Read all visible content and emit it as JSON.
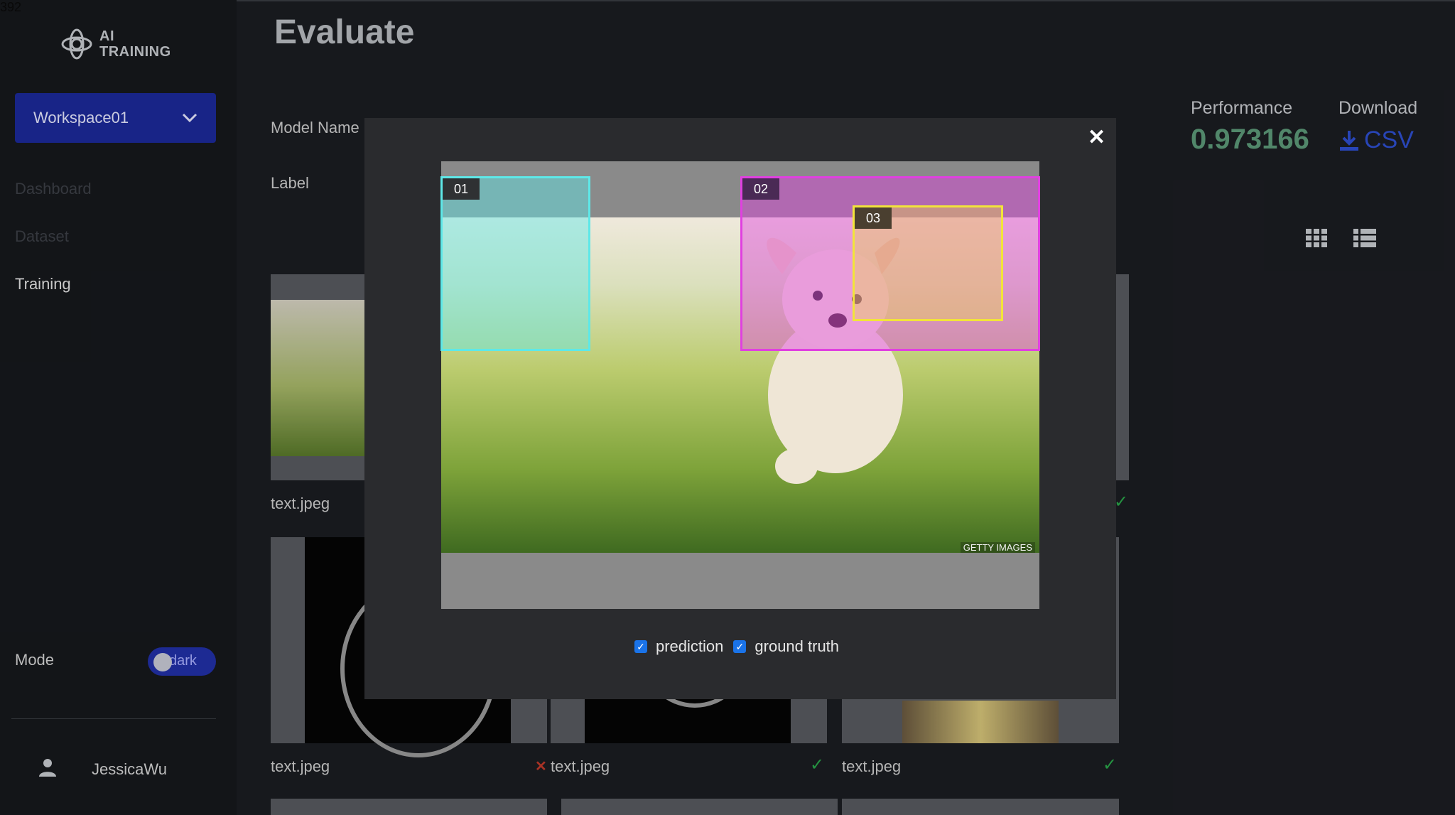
{
  "corner_text": "392",
  "sidebar": {
    "logo_line1": "AI",
    "logo_line2": "TRAINING",
    "workspace": "Workspace01",
    "nav": [
      {
        "label": "Dashboard",
        "active": false
      },
      {
        "label": "Dataset",
        "active": false
      },
      {
        "label": "Training",
        "active": true
      }
    ],
    "mode_label": "Mode",
    "mode_toggle_text": "dark",
    "user_name": "JessicaWu"
  },
  "main": {
    "title": "Evaluate",
    "model_name_label": "Model Name",
    "label_label": "Label",
    "performance_label": "Performance",
    "performance_value": "0.973166",
    "download_label": "Download",
    "download_format": "CSV",
    "grid": [
      {
        "filename": "text.jpeg",
        "status": "correct"
      },
      {
        "filename": "text.jpeg",
        "status": "none"
      },
      {
        "filename": "text.jpeg",
        "status": "incorrect"
      },
      {
        "filename": "text.jpeg",
        "status": "correct"
      },
      {
        "filename": "text.jpeg",
        "status": "correct"
      }
    ]
  },
  "modal": {
    "watermark": "GETTY IMAGES",
    "boxes": [
      {
        "id": "01",
        "color": "#5ee8e8"
      },
      {
        "id": "02",
        "color": "#e040e0"
      },
      {
        "id": "03",
        "color": "#f2e43a"
      }
    ],
    "toggles": [
      {
        "label": "prediction",
        "checked": true
      },
      {
        "label": "ground truth",
        "checked": true
      }
    ]
  },
  "colors": {
    "accent": "#1c2a9a",
    "performance": "#5d9a79",
    "download": "#2e4fd1",
    "success": "#2aa84a",
    "error": "#c0392b"
  }
}
